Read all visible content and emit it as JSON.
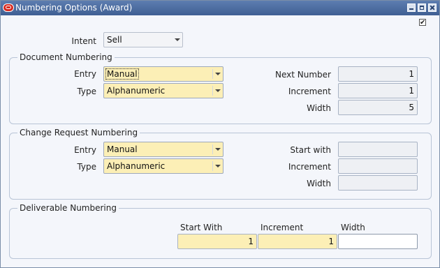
{
  "window": {
    "title": "Numbering Options (Award)"
  },
  "intent": {
    "label": "Intent",
    "value": "Sell"
  },
  "document_numbering": {
    "legend": "Document Numbering",
    "entry_label": "Entry",
    "entry_value": "Manual",
    "type_label": "Type",
    "type_value": "Alphanumeric",
    "next_number_label": "Next Number",
    "next_number_value": "1",
    "increment_label": "Increment",
    "increment_value": "1",
    "width_label": "Width",
    "width_value": "5"
  },
  "change_request_numbering": {
    "legend": "Change Request Numbering",
    "entry_label": "Entry",
    "entry_value": "Manual",
    "type_label": "Type",
    "type_value": "Alphanumeric",
    "start_with_label": "Start with",
    "start_with_value": "",
    "increment_label": "Increment",
    "increment_value": "",
    "width_label": "Width",
    "width_value": ""
  },
  "deliverable_numbering": {
    "legend": "Deliverable Numbering",
    "start_with_label": "Start With",
    "start_with_value": "1",
    "increment_label": "Increment",
    "increment_value": "1",
    "width_label": "Width",
    "width_value": ""
  },
  "checkbox_mark": "✔"
}
